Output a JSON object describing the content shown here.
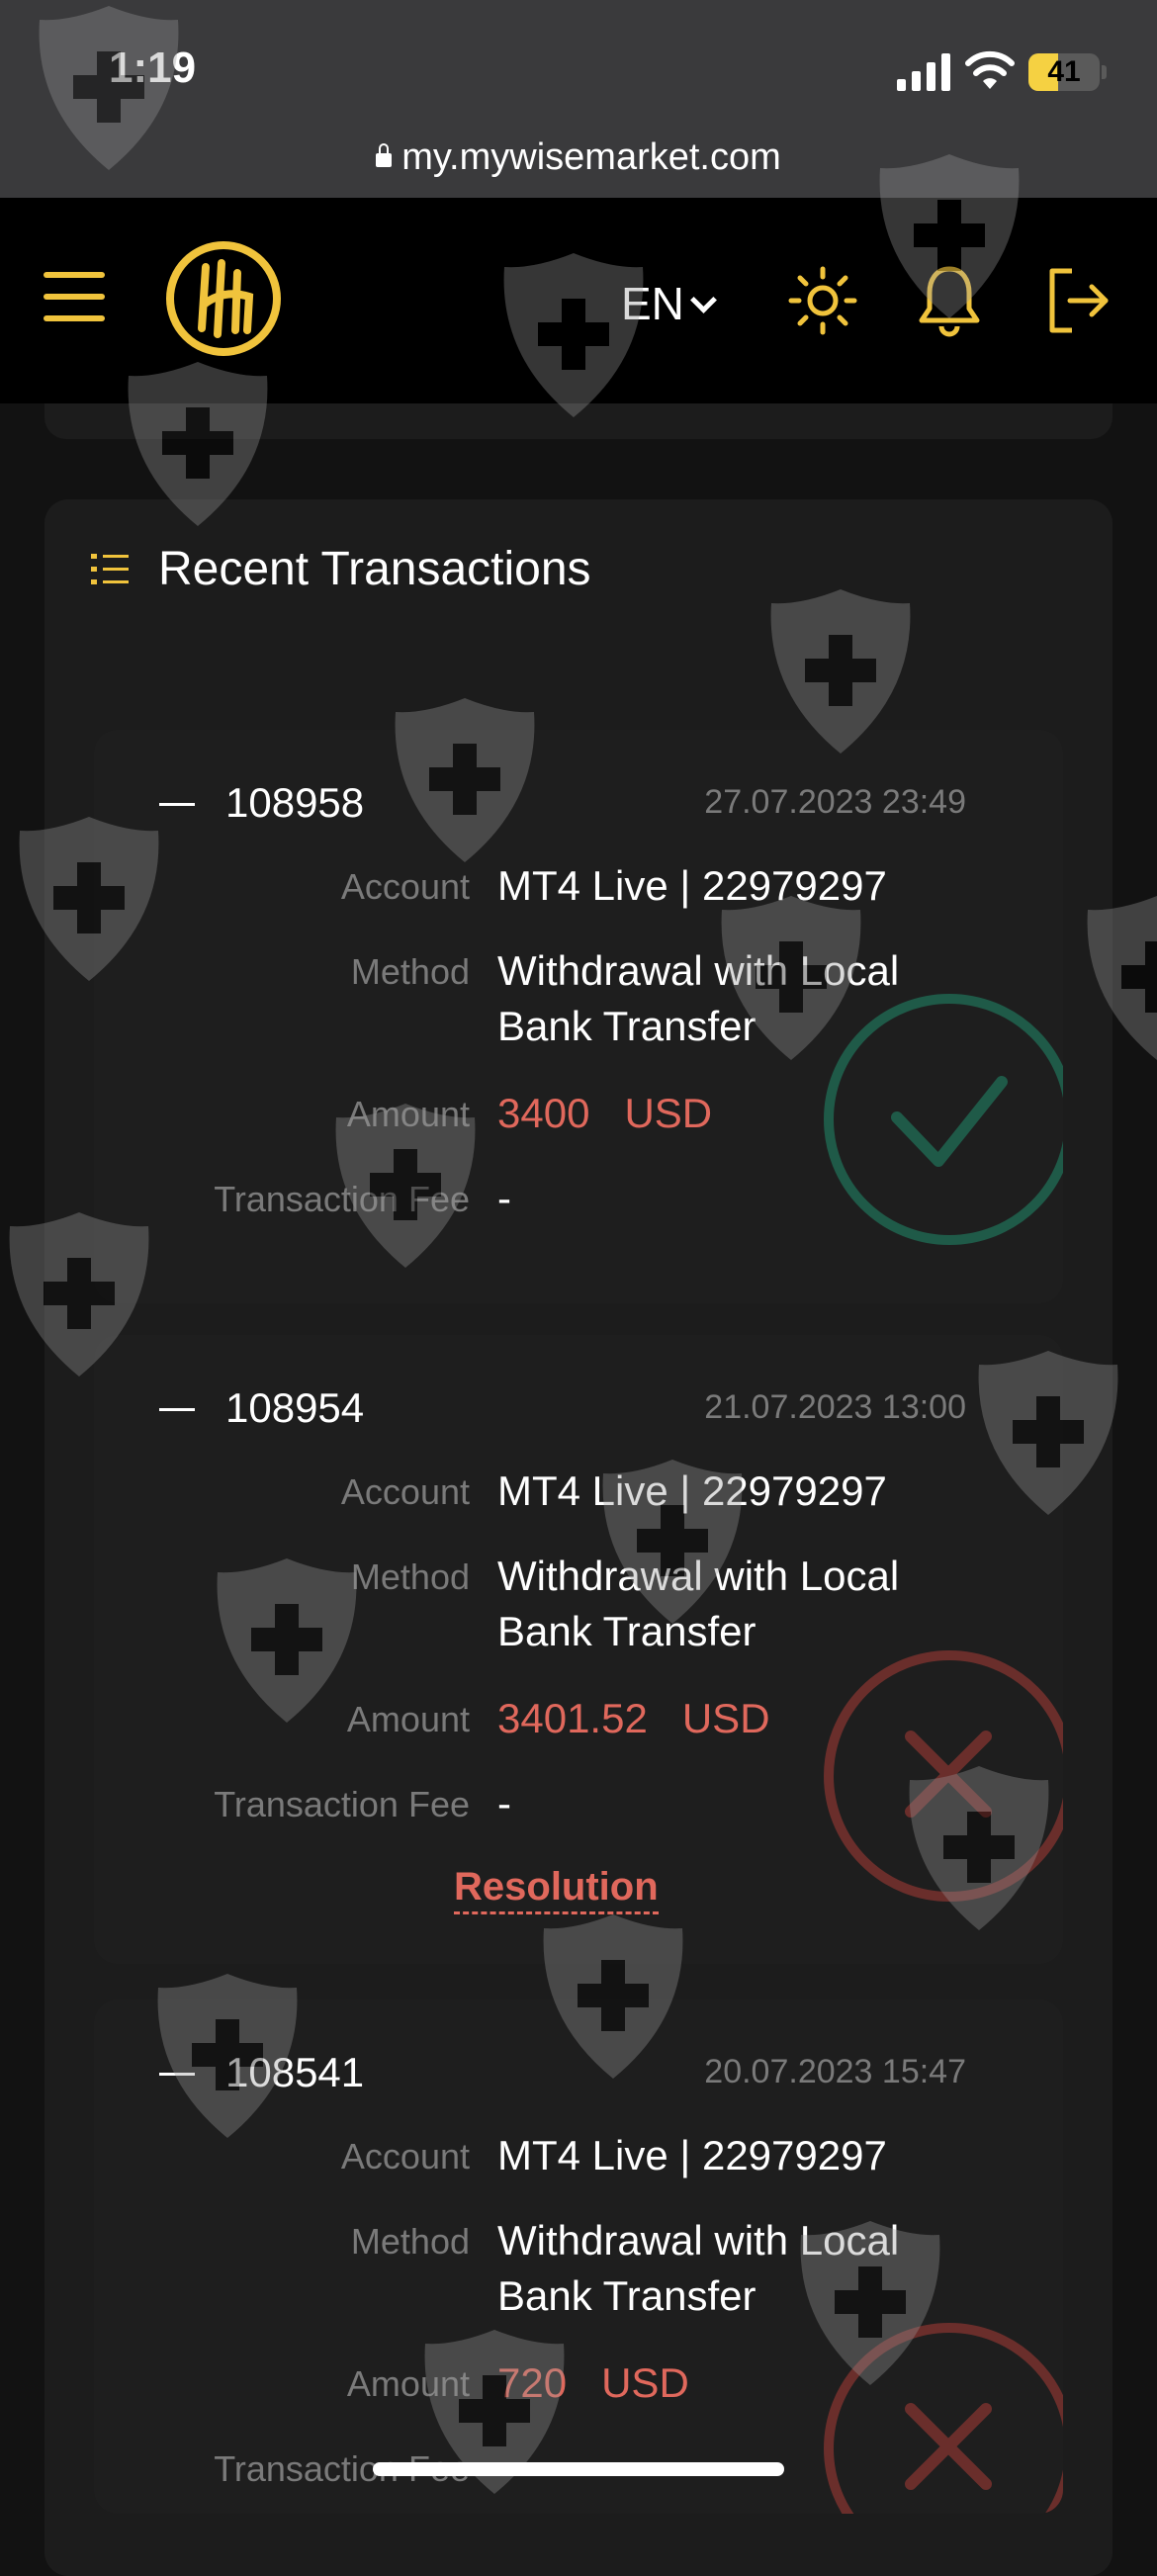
{
  "status_bar": {
    "time": "1:19",
    "battery": "41",
    "battery_level": 0.41,
    "url": "my.mywisemarket.com"
  },
  "header": {
    "language": "EN",
    "icons": [
      "menu-icon",
      "logo",
      "sun-icon",
      "bell-icon",
      "logout-icon"
    ]
  },
  "section": {
    "title": "Recent Transactions"
  },
  "labels": {
    "account": "Account",
    "method": "Method",
    "amount": "Amount",
    "fee": "Transaction Fee"
  },
  "transactions": [
    {
      "id": "108958",
      "date": "27.07.2023 23:49",
      "account": "MT4 Live | 22979297",
      "method_line1": "Withdrawal with Local",
      "method_line2": "Bank Transfer",
      "amount": "3400",
      "currency": "USD",
      "fee": "-",
      "status": "approved"
    },
    {
      "id": "108954",
      "date": "21.07.2023 13:00",
      "account": "MT4 Live | 22979297",
      "method_line1": "Withdrawal with Local",
      "method_line2": "Bank Transfer",
      "amount": "3401.52",
      "currency": "USD",
      "fee": "-",
      "resolution": "Resolution",
      "status": "rejected"
    },
    {
      "id": "108541",
      "date": "20.07.2023 15:47",
      "account": "MT4 Live | 22979297",
      "method_line1": "Withdrawal with Local",
      "method_line2": "Bank Transfer",
      "amount": "720",
      "currency": "USD",
      "status": "rejected"
    }
  ],
  "colors": {
    "accent": "#f0c33c",
    "negative": "#e0685c",
    "approved": "#1f5a48",
    "rejected": "#6a2e2b"
  }
}
